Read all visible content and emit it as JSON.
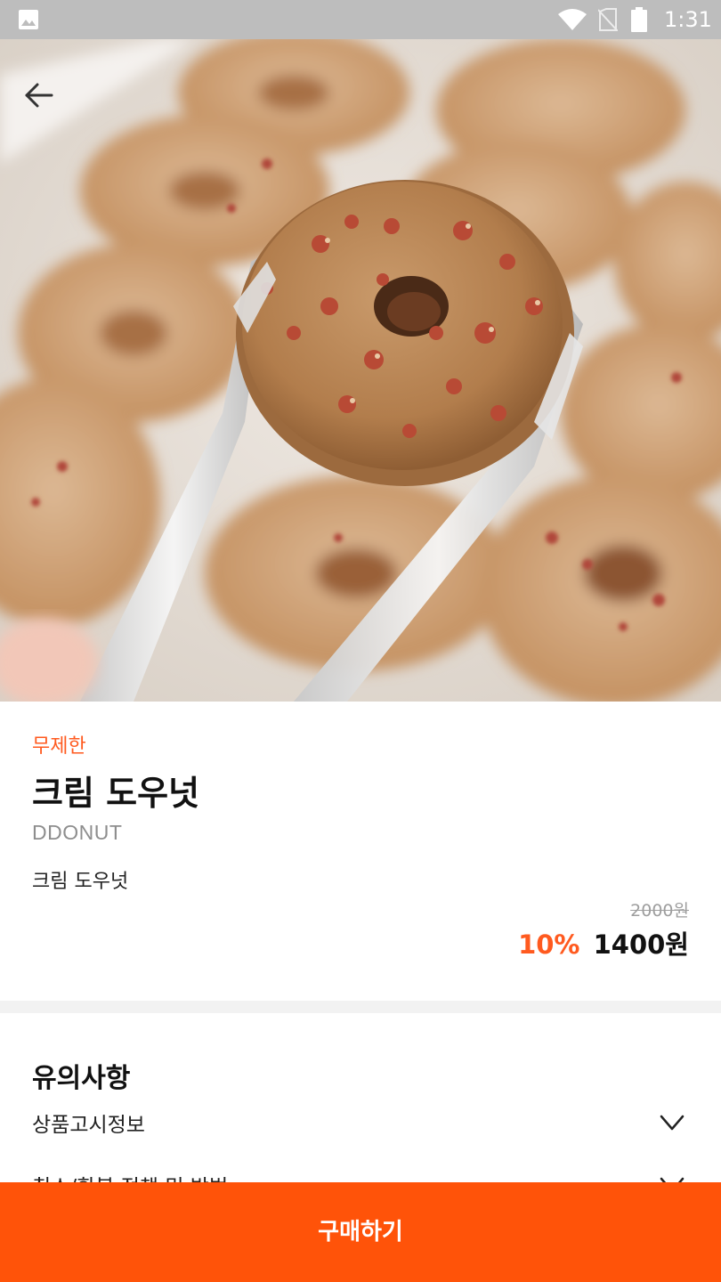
{
  "status_bar": {
    "time": "1:31",
    "icons": [
      "gallery-icon",
      "wifi-icon",
      "no-sim-icon",
      "battery-icon"
    ]
  },
  "hero": {
    "image": "donut-photo",
    "back_icon": "arrow-left-icon"
  },
  "product": {
    "badge": "무제한",
    "title": "크림 도우넛",
    "brand": "DDONUT",
    "description": "크림 도우넛",
    "original_price": "2000원",
    "discount": "10%",
    "price": "1400원"
  },
  "notice": {
    "title": "유의사항",
    "items": [
      {
        "label": "상품고시정보",
        "icon": "chevron-down-icon"
      },
      {
        "label": "취소/환불 정책 및 방법",
        "icon": "chevron-down-icon"
      }
    ]
  },
  "buy_button": {
    "label": "구매하기"
  },
  "colors": {
    "accent": "#ff5309",
    "badge_text": "#ff5a1f",
    "status_bar": "#bdbdbd",
    "section_divider": "#f2f2f2"
  }
}
